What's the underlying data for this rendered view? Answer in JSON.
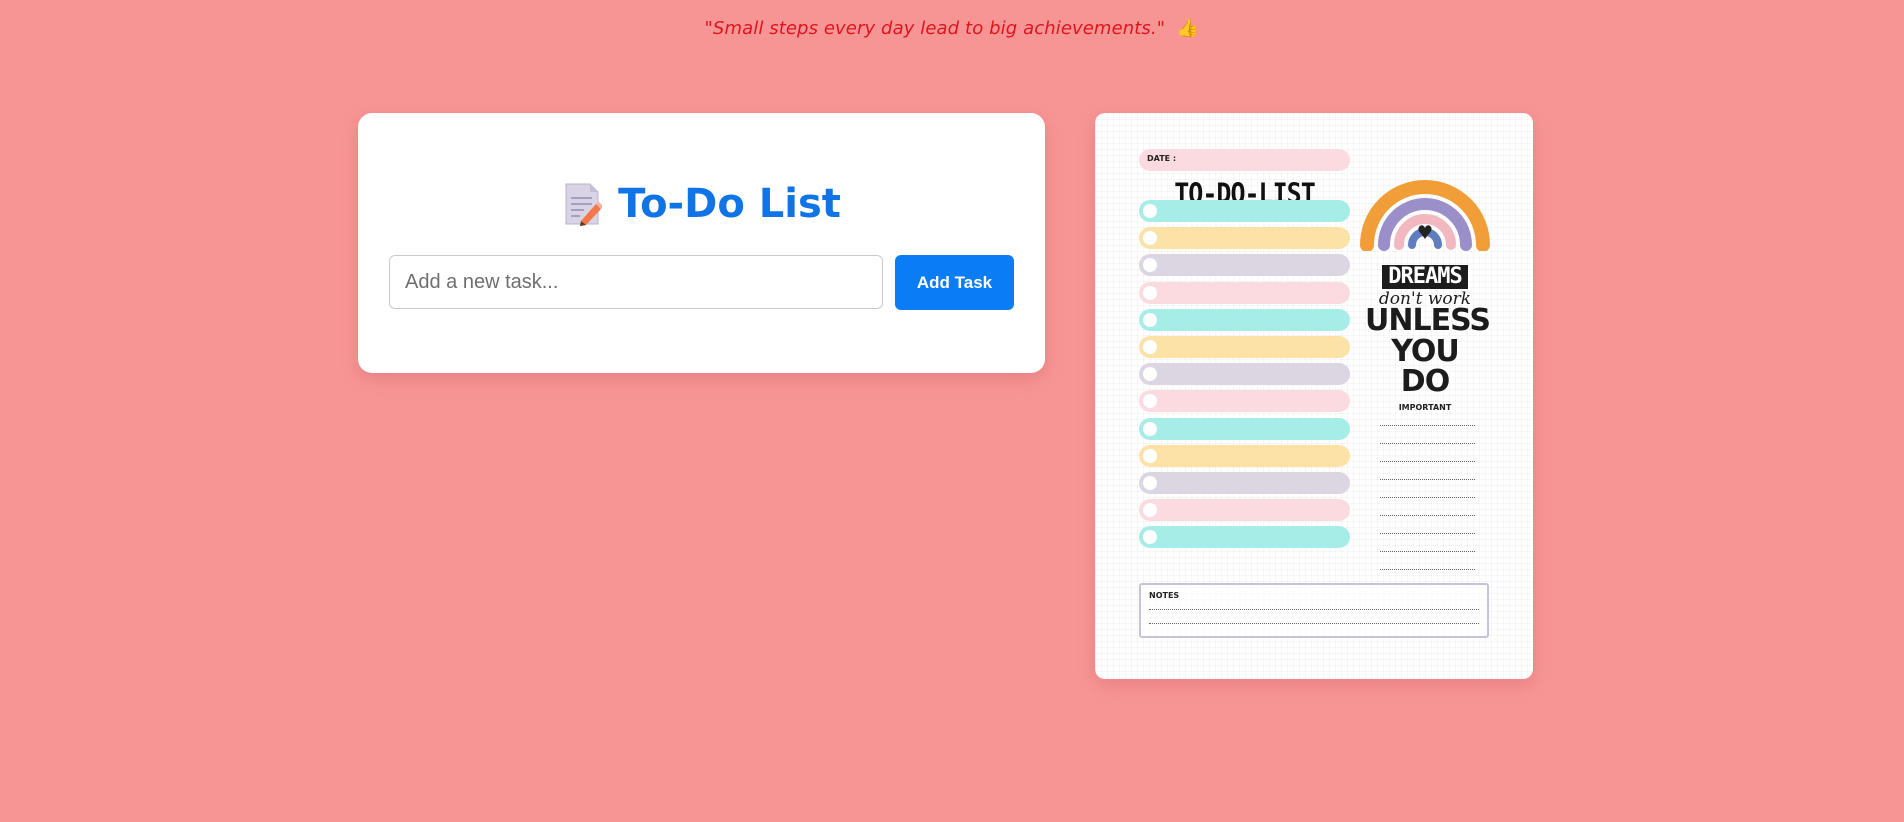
{
  "quote": {
    "text": "\"Small steps every day lead to big achievements.\"",
    "emoji": "👍"
  },
  "todo": {
    "title": "To-Do List",
    "icon": "memo-icon",
    "input_placeholder": "Add a new task...",
    "input_value": "",
    "add_button_label": "Add Task"
  },
  "planner": {
    "date_label": "DATE :",
    "title": "TO-DO-LIST",
    "rows": [
      {
        "color": "#a6ede8"
      },
      {
        "color": "#fde2a8"
      },
      {
        "color": "#dcd6e3"
      },
      {
        "color": "#fcdbe0"
      },
      {
        "color": "#a6ede8"
      },
      {
        "color": "#fde2a8"
      },
      {
        "color": "#dcd6e3"
      },
      {
        "color": "#fcdbe0"
      },
      {
        "color": "#a6ede8"
      },
      {
        "color": "#fde2a8"
      },
      {
        "color": "#dcd6e3"
      },
      {
        "color": "#fcdbe0"
      },
      {
        "color": "#a6ede8"
      }
    ],
    "quote_line1": "DREAMS",
    "quote_line2": "don't work",
    "quote_line3": "UNLESS",
    "quote_line4": "YOU DO",
    "important_label": "IMPORTANT",
    "notes_label": "NOTES"
  },
  "colors": {
    "background": "#f79595",
    "accent": "#0a7cf5",
    "title": "#1074e6",
    "quote": "#e0141e"
  }
}
